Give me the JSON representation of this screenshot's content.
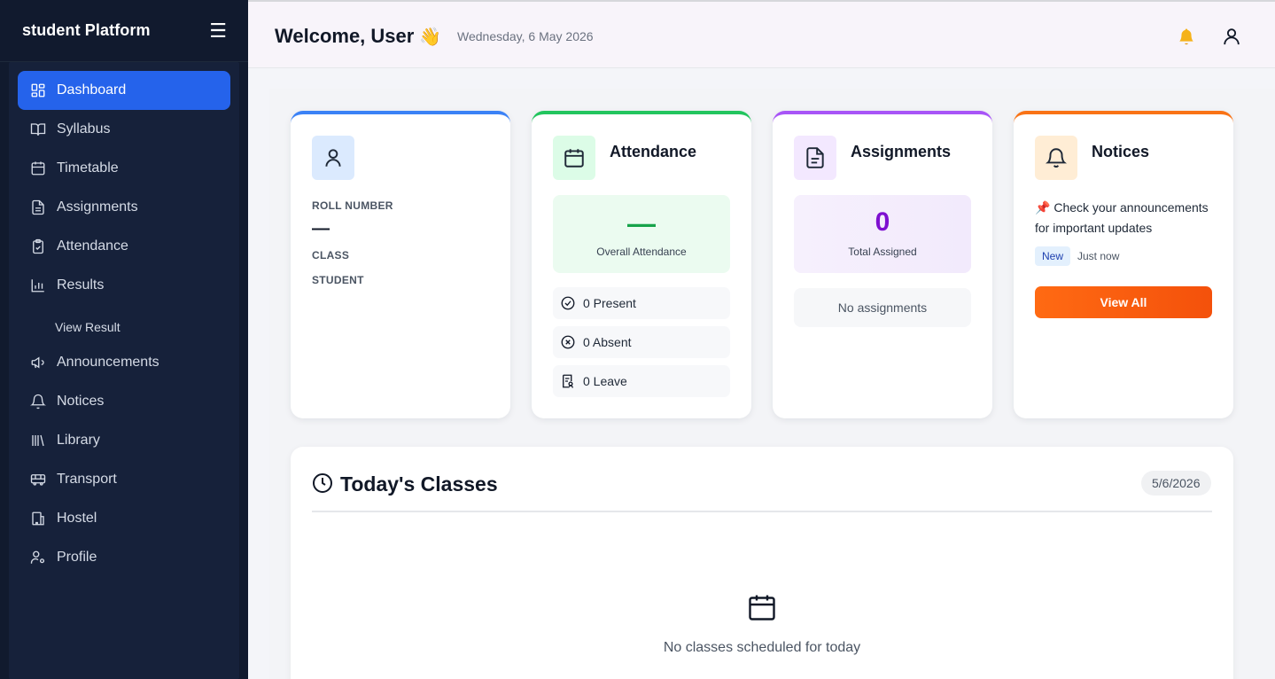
{
  "sidebar": {
    "brand": "student Platform",
    "menu_icon": "hamburger-menu-icon",
    "items": [
      {
        "label": "Dashboard",
        "icon": "grid-icon",
        "active": true
      },
      {
        "label": "Syllabus",
        "icon": "book-icon"
      },
      {
        "label": "Timetable",
        "icon": "calendar-icon"
      },
      {
        "label": "Assignments",
        "icon": "document-icon"
      },
      {
        "label": "Attendance",
        "icon": "clipboard-check-icon"
      },
      {
        "label": "Results",
        "icon": "bar-chart-icon"
      },
      {
        "label": "View Result",
        "sub": true
      },
      {
        "label": "Announcements",
        "icon": "megaphone-icon"
      },
      {
        "label": "Notices",
        "icon": "bell-icon"
      },
      {
        "label": "Library",
        "icon": "library-icon"
      },
      {
        "label": "Transport",
        "icon": "bus-icon"
      },
      {
        "label": "Hostel",
        "icon": "building-icon"
      },
      {
        "label": "Profile",
        "icon": "user-settings-icon"
      }
    ]
  },
  "header": {
    "welcome": "Welcome, User",
    "wave": "👋",
    "date": "Wednesday, 6 May 2026",
    "bell": "🔔"
  },
  "profile_card": {
    "roll_label": "ROLL NUMBER",
    "roll_value": "—",
    "class_label": "CLASS",
    "role_label": "STUDENT"
  },
  "attendance_card": {
    "title": "Attendance",
    "overall_value": "—",
    "overall_label": "Overall Attendance",
    "present": "0 Present",
    "absent": "0 Absent",
    "leave": "0 Leave"
  },
  "assignments_card": {
    "title": "Assignments",
    "total": "0",
    "total_label": "Total Assigned",
    "empty": "No assignments"
  },
  "notices_card": {
    "title": "Notices",
    "pin": "📌",
    "text": "Check your announcements for important updates",
    "badge": "New",
    "time": "Just now",
    "button": "View All"
  },
  "classes": {
    "title": "Today's Classes",
    "date": "5/6/2026",
    "empty": "No classes scheduled for today"
  },
  "colors": {
    "sidebar_bg": "#111a2e",
    "active_item": "#2563eb",
    "blue_accent": "#3b82f6",
    "green_accent": "#22c55e",
    "purple_accent": "#a855f7",
    "orange_accent": "#f97316",
    "assignments_value": "#7e0fd0"
  }
}
